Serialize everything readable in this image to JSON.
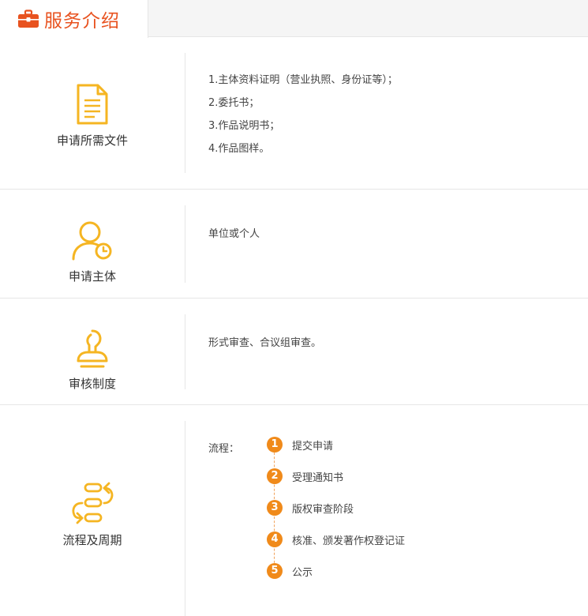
{
  "tab": {
    "title": "服务介绍",
    "icon": "briefcase-icon"
  },
  "colors": {
    "accent": "#e8521f",
    "icon": "#f5b522",
    "step": "#f08a1a"
  },
  "sections": {
    "docs": {
      "label": "申请所需文件",
      "icon": "document-icon",
      "items": [
        "1.主体资料证明（营业执照、身份证等）；",
        "2.委托书；",
        "3.作品说明书；",
        "4.作品图样。"
      ]
    },
    "subject": {
      "label": "申请主体",
      "icon": "user-clock-icon",
      "text": "单位或个人"
    },
    "review": {
      "label": "审核制度",
      "icon": "stamp-icon",
      "text": "形式审查、合议组审查。"
    },
    "process": {
      "label": "流程及周期",
      "icon": "flow-cycle-icon",
      "flow_label": "流程：",
      "steps": [
        {
          "num": "1",
          "text": "提交申请"
        },
        {
          "num": "2",
          "text": "受理通知书"
        },
        {
          "num": "3",
          "text": "版权审查阶段"
        },
        {
          "num": "4",
          "text": "核准、颁发著作权登记证"
        },
        {
          "num": "5",
          "text": "公示"
        }
      ]
    }
  }
}
